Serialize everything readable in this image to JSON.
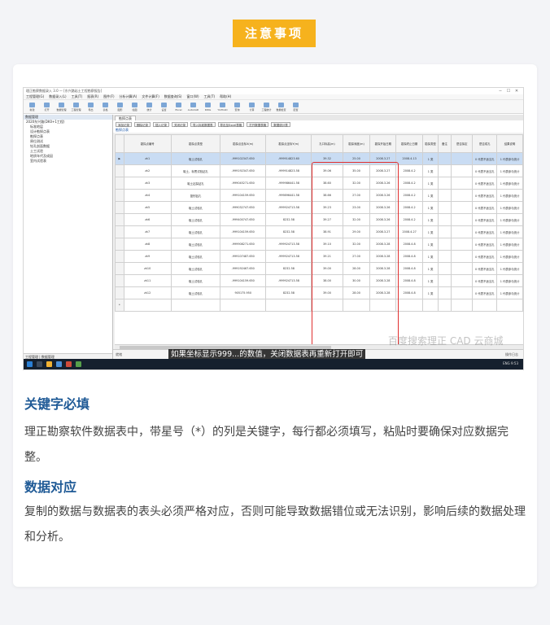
{
  "banner": {
    "title": "注意事项"
  },
  "window": {
    "title": "理正勘察数据录入 3.0 — [东兴路岩土工程勘察报告]",
    "menus": [
      "工程管理(G)",
      "数据录入(L)",
      "工具(T)",
      "报表(R)",
      "图件(F)",
      "分析计算(A)",
      "文件计算(F)",
      "数据查询(S)",
      "窗口(W)",
      "工具(T)",
      "帮助(H)"
    ],
    "tools": [
      "新建",
      "打开",
      "数据管理",
      "工程管理",
      "导出",
      "表格",
      "图形",
      "绘图",
      "统计",
      "设置",
      "Excel",
      "AutoCAD",
      "DWG",
      "YGTCAD",
      "查询",
      "计算",
      "工程统计",
      "数据检查",
      "配置"
    ]
  },
  "tree": {
    "header": "数据管理",
    "items": [
      "2020东兴路(DK0+1工程)",
      "标准地层",
      "设计勘探点表",
      "勘探点表",
      "原位测试",
      "钻孔剖面数据",
      "土工试验",
      "地质年代及成因",
      "室内试验表"
    ],
    "footer": "工程管理 | 数据管理"
  },
  "datatab": {
    "tab": "勘探点表",
    "subtitle": "勘探点表"
  },
  "buttons": [
    "添加记录",
    "删除记录",
    "插入记录",
    "关闭记录",
    "导入标准数据表",
    "导出至Excel表格",
    "打开数据表格",
    "数据统计表"
  ],
  "table": {
    "headers": [
      "勘探点编号",
      "勘探点类型",
      "勘探点坐标X(m)",
      "勘探点坐标Y(m)",
      "孔口标高(m)",
      "勘探深度(m)",
      "勘探开始日期",
      "勘探终止日期",
      "勘探类型",
      "备注",
      "是否拟定",
      "是否成孔",
      "结果说明"
    ],
    "rows": [
      [
        "zk1",
        "取土试验孔",
        "-999102347.650",
        "-999914823.60",
        "39.32",
        "25.00",
        "2008.3.27",
        "2008.4.13",
        "1 类",
        "",
        "",
        "0 代表不适当孔",
        "1 代表参与统计"
      ],
      [
        "zk2",
        "取土、标贯试验钻孔",
        "-999192347.650",
        "-999914823.58",
        "39.06",
        "35.00",
        "2008.3.27",
        "2008.4.2",
        "1 类",
        "",
        "",
        "0 代表不适当孔",
        "1 代表参与统计"
      ],
      [
        "zk3",
        "取土钻探钻孔",
        "-999045271.650",
        "-999986441.58",
        "38.60",
        "32.00",
        "2008.3.26",
        "2008.4.2",
        "1 类",
        "",
        "",
        "0 代表不适当孔",
        "1 代表参与统计"
      ],
      [
        "zk4",
        "鉴别钻孔",
        "-999104159.650",
        "-999896441.58",
        "38.66",
        "27.00",
        "2008.3.26",
        "2008.4.2",
        "1 类",
        "",
        "",
        "0 代表不适当孔",
        "1 代表参与统计"
      ],
      [
        "zk5",
        "取土试验孔",
        "-999032747.650",
        "-999924713.58",
        "39.23",
        "23.00",
        "2008.3.26",
        "2008.4.2",
        "1 类",
        "",
        "",
        "0 代表不适当孔",
        "1 代表参与统计"
      ],
      [
        "zk6",
        "取土试验孔",
        "-999400747.650",
        "8232.58",
        "39.27",
        "32.00",
        "2008.3.26",
        "2008.4.2",
        "1 类",
        "",
        "",
        "0 代表不适当孔",
        "1 代表参与统计"
      ],
      [
        "zk7",
        "取土试验孔",
        "-999104159.650",
        "8232.58",
        "38.91",
        "29.00",
        "2008.3.27",
        "2008.4.27",
        "1 类",
        "",
        "",
        "0 代表不适当孔",
        "1 代表参与统计"
      ],
      [
        "zk8",
        "取土试验孔",
        "-999908271.650",
        "-999924713.58",
        "39.10",
        "32.00",
        "2008.3.28",
        "2008.4.8",
        "1 类",
        "",
        "",
        "0 代表不适当孔",
        "1 代表参与统计"
      ],
      [
        "zk9",
        "取土试验孔",
        "-999107487.650",
        "-999924713.58",
        "39.21",
        "27.00",
        "2008.3.28",
        "2008.4.8",
        "1 类",
        "",
        "",
        "0 代表不适当孔",
        "1 代表参与统计"
      ],
      [
        "zk10",
        "取土试验孔",
        "-999192467.650",
        "8232.58",
        "39.00",
        "28.00",
        "2008.3.28",
        "2008.4.8",
        "1 类",
        "",
        "",
        "0 代表不适当孔",
        "1 代表参与统计"
      ],
      [
        "zk11",
        "取土试验孔",
        "-999104159.650",
        "-999924713.58",
        "38.00",
        "30.00",
        "2008.3.28",
        "2008.4.8",
        "1 类",
        "",
        "",
        "0 代表不适当孔",
        "1 代表参与统计"
      ],
      [
        "zk12",
        "取土试验孔",
        "905175.950",
        "8232.58",
        "39.00",
        "28.00",
        "2008.3.28",
        "2008.4.8",
        "1 类",
        "",
        "",
        "0 代表不适当孔",
        "1 代表参与统计"
      ]
    ],
    "selected_row": 0
  },
  "status": {
    "left": "就绪",
    "right": "操作日志"
  },
  "watermark": "百度搜索理正 CAD 云商城",
  "caption": "如果坐标显示999...的数值，关闭数据表再重新打开即可",
  "tray": "ENG 9:53",
  "section1": {
    "title": "关键字必填",
    "body": "理正勘察软件数据表中，带星号（*）的列是关键字，每行都必须填写，粘贴时要确保对应数据完整。"
  },
  "section2": {
    "title": "数据对应",
    "body": "复制的数据与数据表的表头必须严格对应，否则可能导致数据错位或无法识别，影响后续的数据处理和分析。"
  },
  "colors": {
    "banner": "#f6b21d",
    "heading": "#1f5a96",
    "highlight": "#e03030",
    "selected_row": "#c9dcf3"
  }
}
